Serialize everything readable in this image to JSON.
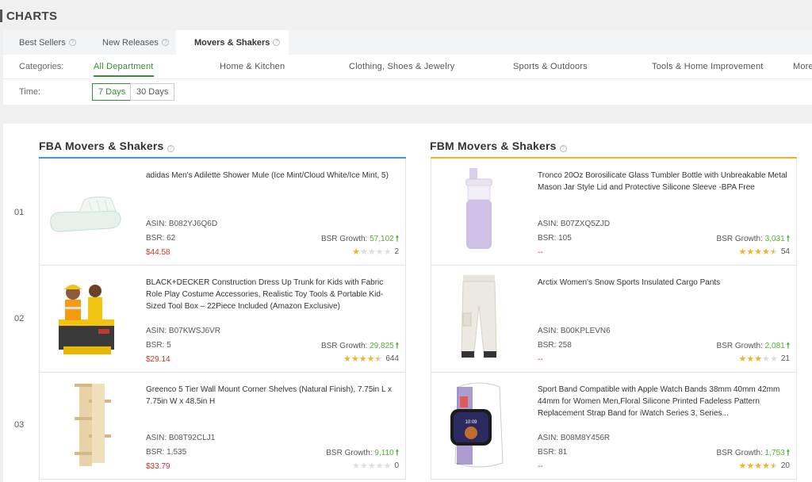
{
  "page_title": "CHARTS",
  "tabs": [
    {
      "label": "Best Sellers",
      "help": "?"
    },
    {
      "label": "New Releases",
      "help": "?"
    },
    {
      "label": "Movers & Shakers",
      "help": "?"
    }
  ],
  "filters": {
    "categories_label": "Categories:",
    "categories": [
      "All Department",
      "Home & Kitchen",
      "Clothing, Shoes & Jewelry",
      "Sports & Outdoors",
      "Tools & Home Improvement",
      "More"
    ],
    "time_label": "Time:",
    "time_options": [
      "7 Days",
      "30 Days"
    ]
  },
  "fba": {
    "title": "FBA Movers & Shakers",
    "help": "?",
    "accent_color": "#4a90e2",
    "items": [
      {
        "rank": "01",
        "name": "adidas Men's Adilette Shower Mule (Ice Mint/Cloud White/Ice Mint, 5)",
        "asin": "ASIN: B082YJ6Q6D",
        "bsr": "BSR: 62",
        "price": "$44.58",
        "growth_label": "BSR Growth:",
        "growth": "57,102",
        "rating": 1,
        "reviews": "2"
      },
      {
        "rank": "02",
        "name": "BLACK+DECKER Construction Dress Up Trunk for Kids with Fabric Role Play Costume Accessories, Realistic Toy Tools & Portable Kid-Sized Tool Box – 22Piece Included (Amazon Exclusive)",
        "asin": "ASIN: B07KWSJ6VR",
        "bsr": "BSR: 5",
        "price": "$29.14",
        "growth_label": "BSR Growth:",
        "growth": "29,825",
        "rating": 4.5,
        "reviews": "644"
      },
      {
        "rank": "03",
        "name": "Greenco 5 Tier Wall Mount Corner Shelves (Natural Finish), 7.75in L x 7.75in W x 48.5in H",
        "asin": "ASIN: B08T92CLJ1",
        "bsr": "BSR: 1,535",
        "price": "$33.79",
        "growth_label": "BSR Growth:",
        "growth": "9,110",
        "rating": 0,
        "reviews": "0"
      }
    ]
  },
  "fbm": {
    "title": "FBM Movers & Shakers",
    "help": "?",
    "accent_color": "#f0b429",
    "items": [
      {
        "name": "Tronco 20Oz Borosilicate Glass Tumbler Bottle with Unbreakable Metal Mason Jar Style Lid and Protective Silicone Sleeve -BPA Free",
        "asin": "ASIN: B07ZXQ5ZJD",
        "bsr": "BSR: 105",
        "price": "--",
        "growth_label": "BSR Growth:",
        "growth": "3,031",
        "rating": 4.5,
        "reviews": "54"
      },
      {
        "name": "Arctix Women's Snow Sports Insulated Cargo Pants",
        "asin": "ASIN: B00KPLEVN6",
        "bsr": "BSR: 258",
        "price": "--",
        "growth_label": "BSR Growth:",
        "growth": "2,081",
        "rating": 3,
        "reviews": "21"
      },
      {
        "name": "Sport Band Compatible with Apple Watch Bands 38mm 40mm 42mm 44mm for Women Men,Floral Silicone Printed Fadeless Pattern Replacement Strap Band for iWatch Series 3, Series...",
        "asin": "ASIN: B08M8Y456R",
        "bsr": "BSR: 81",
        "price": "--",
        "growth_label": "BSR Growth:",
        "growth": "1,753",
        "rating": 4.5,
        "reviews": "20"
      }
    ]
  },
  "icons": {
    "help": "question-circle-icon",
    "growth": "arrow-up-icon",
    "star": "star-icon"
  }
}
